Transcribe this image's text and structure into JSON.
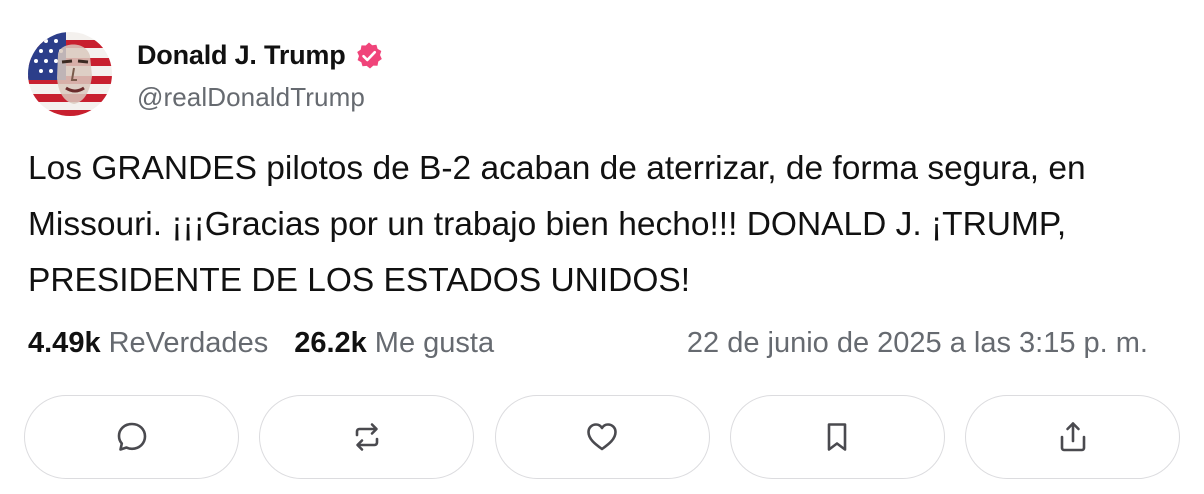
{
  "post": {
    "author_name": "Donald J. Trump",
    "handle": "@realDonaldTrump",
    "verified_color": "#f0447a",
    "text": "Los GRANDES pilotos de B-2 acaban de aterrizar, de forma segura, en Missouri. ¡¡¡Gracias por un trabajo bien hecho!!! DONALD J. ¡TRUMP, PRESIDENTE DE LOS ESTADOS UNIDOS!",
    "stats": {
      "reposts_count": "4.49k",
      "reposts_label": "ReVerdades",
      "likes_count": "26.2k",
      "likes_label": "Me gusta"
    },
    "timestamp": "22 de junio de 2025 a las 3:15 p. m."
  },
  "actions": [
    {
      "icon": "comment-icon"
    },
    {
      "icon": "repost-icon"
    },
    {
      "icon": "heart-icon"
    },
    {
      "icon": "bookmark-icon"
    },
    {
      "icon": "share-icon"
    }
  ]
}
